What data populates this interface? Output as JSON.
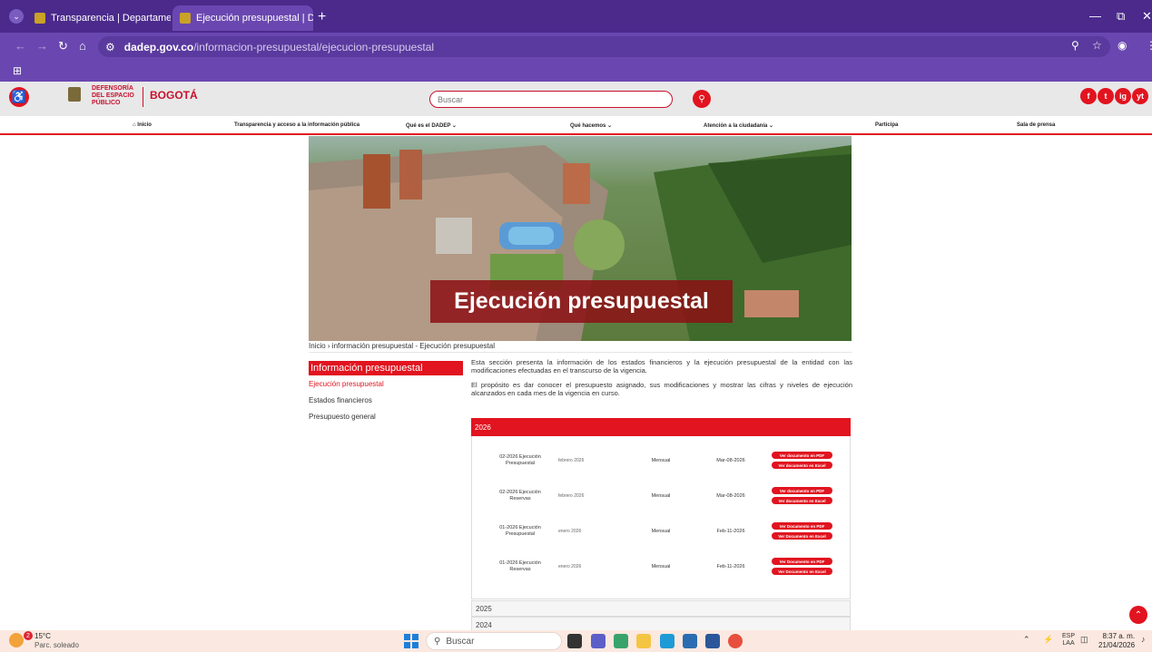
{
  "browser": {
    "tabs": [
      {
        "title": "Transparencia | Departamento /"
      },
      {
        "title": "Ejecución presupuestal | Depar"
      }
    ],
    "url_host": "dadep.gov.co",
    "url_path": "/informacion-presupuestal/ejecucion-presupuestal"
  },
  "site": {
    "logo_text": "DEFENSORÍA DEL ESPACIO PÚBLICO",
    "logo_bogota": "BOGOTÁ",
    "search_placeholder": "Buscar",
    "nav": [
      "Inicio",
      "Transparencia y acceso a la información pública",
      "Qué es el DADEP",
      "Qué hacemos",
      "Atención a la ciudadanía",
      "Participa",
      "Sala de prensa"
    ],
    "social": [
      "f",
      "t",
      "ig",
      "yt"
    ]
  },
  "hero": {
    "title": "Ejecución presupuestal"
  },
  "breadcrumb": "Inicio  ›  información presupuestal - Ejecución presupuestal",
  "sidebar": {
    "heading": "Información presupuestal",
    "links": [
      "Ejecución presupuestal",
      "Estados financieros",
      "Presupuesto general"
    ]
  },
  "intro": {
    "p1": "Esta sección presenta la información de los estados financieros y la ejecución presupuestal de la entidad con las modificaciones efectuadas en el transcurso de la vigencia.",
    "p2": "El propósito es dar conocer el presupuesto asignado, sus modificaciones y mostrar las cifras y niveles de ejecución alcanzados en cada mes de la vigencia en curso."
  },
  "accordion": {
    "open_year": "2026",
    "rows": [
      {
        "name": "02-2026 Ejecución Presupuestal",
        "month": "febrero 2026",
        "freq": "Mensual",
        "date": "Mar-08-2026",
        "pdf": "Ver documento en PDF",
        "excel": "Ver documento en Excel"
      },
      {
        "name": "02-2026 Ejecución Reservas",
        "month": "febrero 2026",
        "freq": "Mensual",
        "date": "Mar-08-2026",
        "pdf": "Ver documento en PDF",
        "excel": "Ver documento en Excel"
      },
      {
        "name": "01-2026 Ejecución Presupuestal",
        "month": "enero 2026",
        "freq": "Mensual",
        "date": "Feb-11-2026",
        "pdf": "Ver Documento en PDF",
        "excel": "Ver Documento en Excel"
      },
      {
        "name": "01-2026 Ejecución Reservas",
        "month": "enero 2026",
        "freq": "Mensual",
        "date": "Feb-11-2026",
        "pdf": "Ver Documento en PDF",
        "excel": "Ver Documento en Excel"
      }
    ],
    "closed_years": [
      "2025",
      "2024"
    ]
  },
  "taskbar": {
    "temp": "15°C",
    "weather": "Parc. soleado",
    "badge": "2",
    "search": "Buscar",
    "lang1": "ESP",
    "lang2": "LAA",
    "time": "8:37 a. m.",
    "date": "21/04/2026"
  },
  "colors": {
    "brand_red": "#e1141f",
    "chrome_purple": "#6a47b0"
  }
}
